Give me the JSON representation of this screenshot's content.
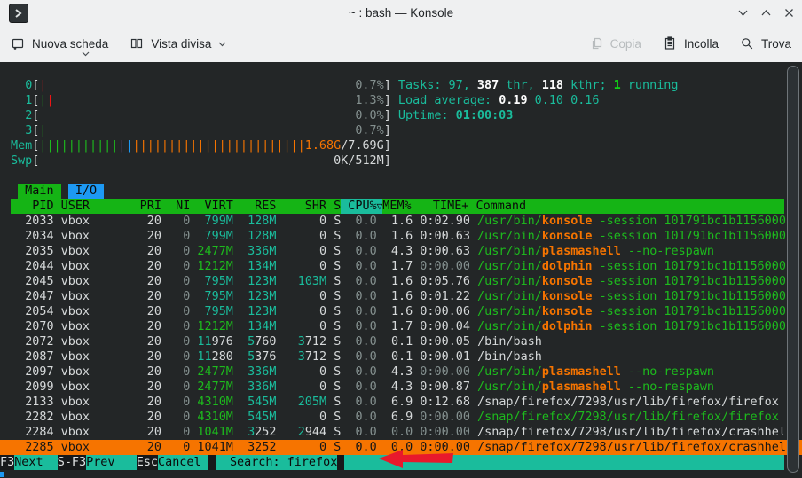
{
  "window": {
    "title": "~ : bash — Konsole"
  },
  "toolbar": {
    "new_tab_label": "Nuova scheda",
    "split_view_label": "Vista divisa",
    "copy_label": "Copia",
    "paste_label": "Incolla",
    "find_label": "Trova"
  },
  "htop": {
    "meters": [
      {
        "name": "cpu0",
        "label": "0",
        "bars": [
          [
            "|",
            "red"
          ]
        ],
        "value": [
          [
            "0.7%",
            "dim"
          ]
        ],
        "right": [
          [
            "Tasks: 97, ",
            "t"
          ],
          [
            "387",
            "wb"
          ],
          [
            " thr, ",
            "t"
          ],
          [
            "118",
            "wb"
          ],
          [
            " kthr; ",
            "t"
          ],
          [
            "1",
            "gb"
          ],
          [
            " running",
            "t"
          ]
        ]
      },
      {
        "name": "cpu1",
        "label": "1",
        "bars": [
          [
            "|",
            "g"
          ],
          [
            "|",
            "red"
          ]
        ],
        "value": [
          [
            "1.3%",
            "dim"
          ]
        ],
        "right": [
          [
            "Load average: ",
            "t"
          ],
          [
            "0.19",
            "wb"
          ],
          [
            " 0.10 0.16",
            "t"
          ]
        ]
      },
      {
        "name": "cpu2",
        "label": "2",
        "bars": [],
        "value": [
          [
            "0.0%",
            "dim"
          ]
        ],
        "right": [
          [
            "Uptime: ",
            "t"
          ],
          [
            "01:00:03",
            "tb"
          ]
        ]
      },
      {
        "name": "cpu3",
        "label": "3",
        "bars": [
          [
            "|",
            "g"
          ]
        ],
        "value": [
          [
            "0.7%",
            "dim"
          ]
        ],
        "right": []
      },
      {
        "name": "mem",
        "label": "Mem",
        "bars": [
          [
            "|||||||||||",
            "g"
          ],
          [
            "|",
            "mag"
          ],
          [
            "|",
            "blu"
          ],
          [
            "||||||||||||||||||||||||",
            "o"
          ]
        ],
        "value": [
          [
            "1.68G",
            "o"
          ],
          [
            "/7.69G",
            "w"
          ]
        ],
        "right": []
      },
      {
        "name": "swp",
        "label": "Swp",
        "bars": [],
        "value": [
          [
            "0K/512M",
            "w"
          ]
        ],
        "right": []
      }
    ],
    "tabs": [
      {
        "id": "main",
        "label": "Main",
        "cls": "tabg"
      },
      {
        "id": "io",
        "label": "I/O",
        "cls": "tabb"
      }
    ],
    "header": {
      "pid": "PID",
      "user": "USER",
      "pri": "PRI",
      "ni": "NI",
      "virt": "VIRT",
      "res": "RES",
      "shr": "SHR",
      "s": "S",
      "cpu": "CPU%",
      "sort": "▽",
      "mem": "MEM%",
      "time": "TIME+",
      "cmd": "Command"
    },
    "rows": [
      {
        "pid": "2033",
        "user": "vbox",
        "pri": "20",
        "ni": "0",
        "virt": [
          [
            "799M",
            "t"
          ]
        ],
        "res": [
          [
            "128M",
            "t"
          ]
        ],
        "shr": "0",
        "s": "S",
        "cpu": "0.0",
        "mem": "1.6",
        "time": "0:02.90",
        "cmd": [
          [
            "/usr/bin/",
            "g"
          ],
          [
            "konsole",
            "ob"
          ],
          [
            " -session 101791bc1b1156000",
            "g"
          ]
        ]
      },
      {
        "pid": "2034",
        "user": "vbox",
        "pri": "20",
        "ni": "0",
        "virt": [
          [
            "799M",
            "t"
          ]
        ],
        "res": [
          [
            "128M",
            "t"
          ]
        ],
        "shr": "0",
        "s": "S",
        "cpu": "0.0",
        "mem": "1.6",
        "time": "0:00.63",
        "cmd": [
          [
            "/usr/bin/",
            "g"
          ],
          [
            "konsole",
            "ob"
          ],
          [
            " -session 101791bc1b1156000",
            "g"
          ]
        ]
      },
      {
        "pid": "2035",
        "user": "vbox",
        "pri": "20",
        "ni": "0",
        "virt": [
          [
            "2477M",
            "g"
          ]
        ],
        "res": [
          [
            "336M",
            "t"
          ]
        ],
        "shr": "0",
        "s": "S",
        "cpu": "0.0",
        "mem": "4.3",
        "time": "0:00.63",
        "cmd": [
          [
            "/usr/bin/",
            "g"
          ],
          [
            "plasmashell",
            "ob"
          ],
          [
            " --no-respawn",
            "g"
          ]
        ]
      },
      {
        "pid": "2044",
        "user": "vbox",
        "pri": "20",
        "ni": "0",
        "virt": [
          [
            "1212M",
            "g"
          ]
        ],
        "res": [
          [
            "134M",
            "t"
          ]
        ],
        "shr": "0",
        "s": "S",
        "cpu": "0.0",
        "mem": "1.7",
        "time": [
          [
            "0:00.00",
            "dim"
          ]
        ],
        "cmd": [
          [
            "/usr/bin/",
            "g"
          ],
          [
            "dolphin",
            "ob"
          ],
          [
            " -session 101791bc1b1156000",
            "g"
          ]
        ]
      },
      {
        "pid": "2045",
        "user": "vbox",
        "pri": "20",
        "ni": "0",
        "virt": [
          [
            "795M",
            "t"
          ]
        ],
        "res": [
          [
            "123M",
            "t"
          ]
        ],
        "shr": [
          [
            "103M",
            "t"
          ]
        ],
        "s": "S",
        "cpu": "0.0",
        "mem": "1.6",
        "time": "0:05.76",
        "cmd": [
          [
            "/usr/bin/",
            "g"
          ],
          [
            "konsole",
            "ob"
          ],
          [
            " -session 101791bc1b1156000",
            "g"
          ]
        ]
      },
      {
        "pid": "2047",
        "user": "vbox",
        "pri": "20",
        "ni": "0",
        "virt": [
          [
            "795M",
            "t"
          ]
        ],
        "res": [
          [
            "123M",
            "t"
          ]
        ],
        "shr": "0",
        "s": "S",
        "cpu": "0.0",
        "mem": "1.6",
        "time": "0:01.22",
        "cmd": [
          [
            "/usr/bin/",
            "g"
          ],
          [
            "konsole",
            "ob"
          ],
          [
            " -session 101791bc1b1156000",
            "g"
          ]
        ]
      },
      {
        "pid": "2054",
        "user": "vbox",
        "pri": "20",
        "ni": "0",
        "virt": [
          [
            "795M",
            "t"
          ]
        ],
        "res": [
          [
            "123M",
            "t"
          ]
        ],
        "shr": "0",
        "s": "S",
        "cpu": "0.0",
        "mem": "1.6",
        "time": "0:00.06",
        "cmd": [
          [
            "/usr/bin/",
            "g"
          ],
          [
            "konsole",
            "ob"
          ],
          [
            " -session 101791bc1b1156000",
            "g"
          ]
        ]
      },
      {
        "pid": "2070",
        "user": "vbox",
        "pri": "20",
        "ni": "0",
        "virt": [
          [
            "1212M",
            "g"
          ]
        ],
        "res": [
          [
            "134M",
            "t"
          ]
        ],
        "shr": "0",
        "s": "S",
        "cpu": "0.0",
        "mem": "1.7",
        "time": "0:00.04",
        "cmd": [
          [
            "/usr/bin/",
            "g"
          ],
          [
            "dolphin",
            "ob"
          ],
          [
            " -session 101791bc1b1156000",
            "g"
          ]
        ]
      },
      {
        "pid": "2072",
        "user": "vbox",
        "pri": "20",
        "ni": "0",
        "virt": [
          [
            "11",
            "t"
          ],
          [
            "976",
            "w"
          ]
        ],
        "res": [
          [
            "5",
            "t"
          ],
          [
            "760",
            "w"
          ]
        ],
        "shr": [
          [
            "3",
            "t"
          ],
          [
            "712",
            "w"
          ]
        ],
        "s": "S",
        "cpu": "0.0",
        "mem": "0.1",
        "time": "0:00.05",
        "cmd": [
          [
            "/bin/bash",
            "w"
          ]
        ]
      },
      {
        "pid": "2087",
        "user": "vbox",
        "pri": "20",
        "ni": "0",
        "virt": [
          [
            "11",
            "t"
          ],
          [
            "280",
            "w"
          ]
        ],
        "res": [
          [
            "5",
            "t"
          ],
          [
            "376",
            "w"
          ]
        ],
        "shr": [
          [
            "3",
            "t"
          ],
          [
            "712",
            "w"
          ]
        ],
        "s": "S",
        "cpu": "0.0",
        "mem": "0.1",
        "time": "0:00.01",
        "cmd": [
          [
            "/bin/bash",
            "w"
          ]
        ]
      },
      {
        "pid": "2097",
        "user": "vbox",
        "pri": "20",
        "ni": "0",
        "virt": [
          [
            "2477M",
            "g"
          ]
        ],
        "res": [
          [
            "336M",
            "t"
          ]
        ],
        "shr": "0",
        "s": "S",
        "cpu": "0.0",
        "mem": "4.3",
        "time": [
          [
            "0:00.00",
            "dim"
          ]
        ],
        "cmd": [
          [
            "/usr/bin/",
            "g"
          ],
          [
            "plasmashell",
            "ob"
          ],
          [
            " --no-respawn",
            "g"
          ]
        ]
      },
      {
        "pid": "2099",
        "user": "vbox",
        "pri": "20",
        "ni": "0",
        "virt": [
          [
            "2477M",
            "g"
          ]
        ],
        "res": [
          [
            "336M",
            "t"
          ]
        ],
        "shr": "0",
        "s": "S",
        "cpu": "0.0",
        "mem": "4.3",
        "time": "0:00.87",
        "cmd": [
          [
            "/usr/bin/",
            "g"
          ],
          [
            "plasmashell",
            "ob"
          ],
          [
            " --no-respawn",
            "g"
          ]
        ]
      },
      {
        "pid": "2133",
        "user": "vbox",
        "pri": "20",
        "ni": "0",
        "virt": [
          [
            "4310M",
            "g"
          ]
        ],
        "res": [
          [
            "545M",
            "t"
          ]
        ],
        "shr": [
          [
            "205M",
            "t"
          ]
        ],
        "s": "S",
        "cpu": "0.0",
        "mem": "6.9",
        "time": "0:12.68",
        "cmd": [
          [
            "/snap/firefox/7298/usr/lib/firefox/firefox",
            "w"
          ]
        ]
      },
      {
        "pid": "2282",
        "user": "vbox",
        "pri": "20",
        "ni": "0",
        "virt": [
          [
            "4310M",
            "g"
          ]
        ],
        "res": [
          [
            "545M",
            "t"
          ]
        ],
        "shr": "0",
        "s": "S",
        "cpu": "0.0",
        "mem": "6.9",
        "time": [
          [
            "0:00.00",
            "dim"
          ]
        ],
        "cmd": [
          [
            "/snap/firefox/7298/usr/lib/firefox/firefox",
            "g"
          ]
        ]
      },
      {
        "pid": "2284",
        "user": "vbox",
        "pri": "20",
        "ni": "0",
        "virt": [
          [
            "1041M",
            "g"
          ]
        ],
        "res": [
          [
            "3",
            "t"
          ],
          [
            "252",
            "w"
          ]
        ],
        "shr": [
          [
            "2",
            "t"
          ],
          [
            "944",
            "w"
          ]
        ],
        "s": "S",
        "cpu": "0.0",
        "mem": [
          [
            "0.0",
            "dim"
          ]
        ],
        "time": [
          [
            "0:00.00",
            "dim"
          ]
        ],
        "cmd": [
          [
            "/snap/firefox/7298/usr/lib/firefox/crashhel",
            "w"
          ]
        ]
      },
      {
        "pid": "2285",
        "user": "vbox",
        "pri": "20",
        "ni": "0",
        "virt": "1041M",
        "res": "3252",
        "shr": "0",
        "s": "S",
        "cpu": "0.0",
        "mem": "0.0",
        "time": "0:00.00",
        "cmd": "/snap/firefox/7298/usr/lib/firefox/crashhel",
        "selected": true
      }
    ],
    "fnbar_buttons": [
      {
        "key": "F3",
        "label": "Next  "
      },
      {
        "key": "S-F3",
        "label": "Prev   "
      },
      {
        "key": "Esc",
        "label": "Cancel "
      }
    ],
    "search": {
      "label": "Search:",
      "query": "firefox"
    }
  }
}
